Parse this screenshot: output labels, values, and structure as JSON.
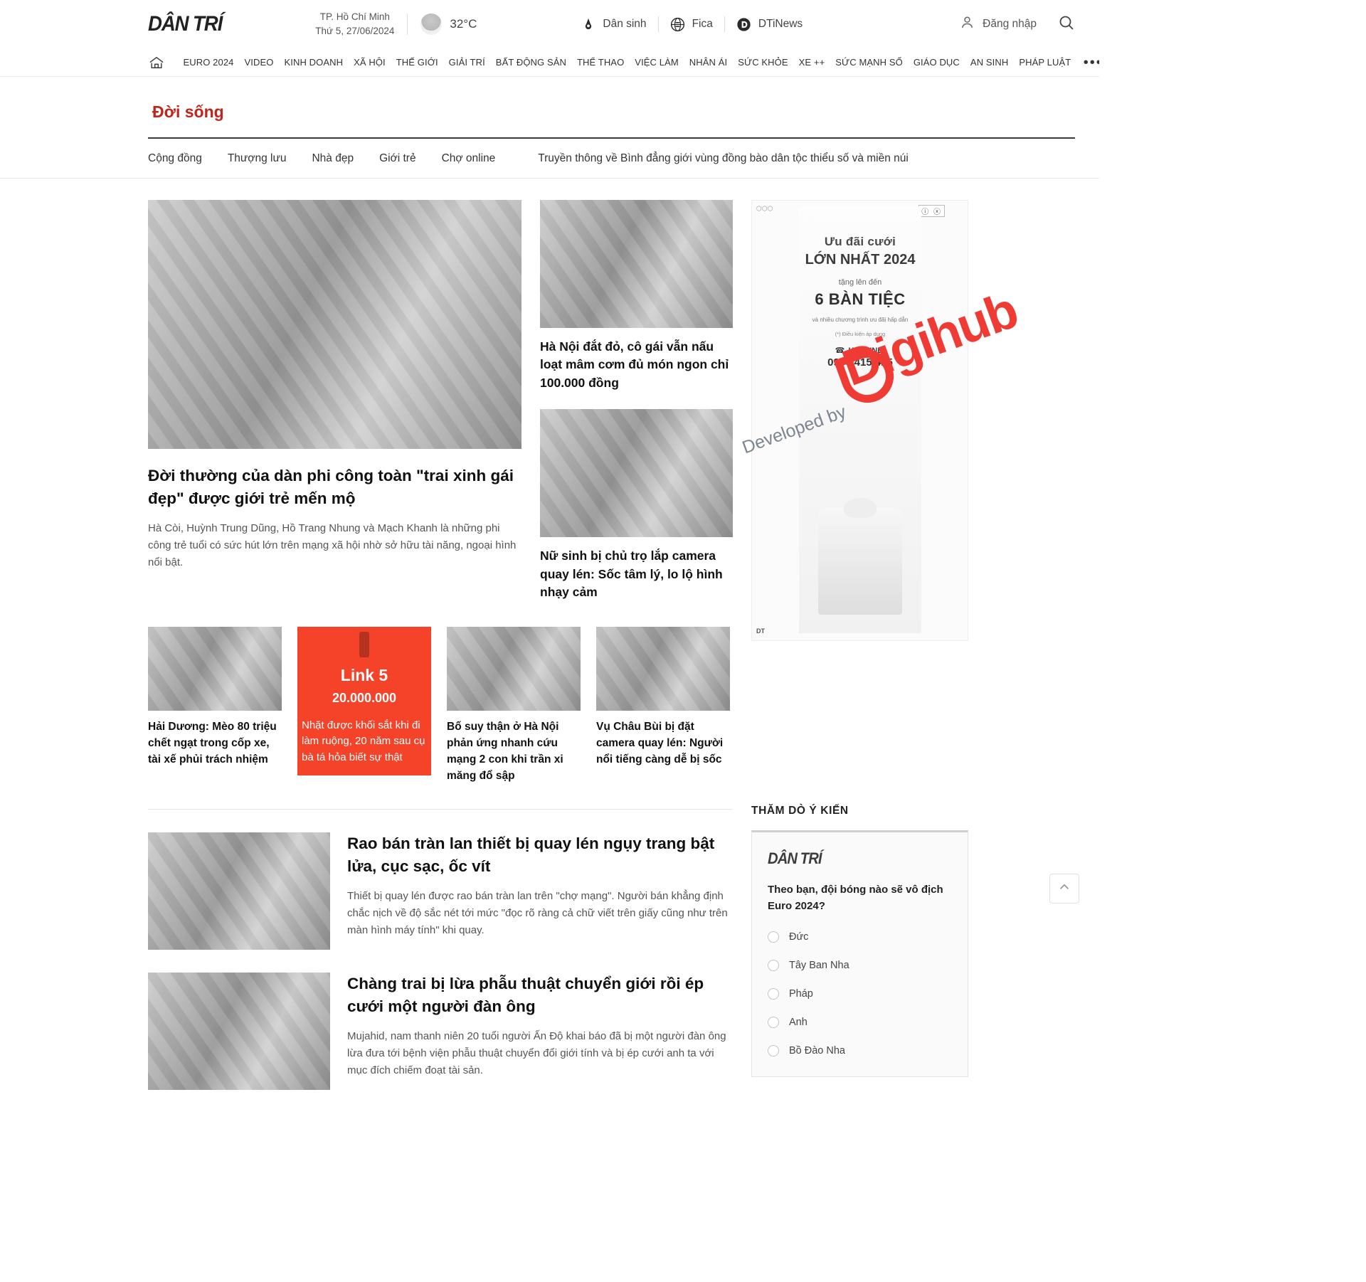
{
  "header": {
    "logo": "DÂN TRÍ",
    "location": "TP. Hồ Chí Minh",
    "date": "Thứ 5, 27/06/2024",
    "temperature": "32°C",
    "weather_icon": "cloud-icon",
    "partners": [
      {
        "label": "Dân sinh",
        "icon": "pen-drop-icon"
      },
      {
        "label": "Fica",
        "icon": "globe-icon"
      },
      {
        "label": "DTiNews",
        "icon": "dtinews-circle-icon"
      }
    ],
    "login_label": "Đăng nhập",
    "login_icon": "user-icon",
    "search_icon": "search-icon"
  },
  "mainnav": {
    "home_icon": "home-icon",
    "items": [
      "EURO 2024",
      "VIDEO",
      "KINH DOANH",
      "XÃ HỘI",
      "THẾ GIỚI",
      "GIẢI TRÍ",
      "BẤT ĐỘNG SẢN",
      "THỂ THAO",
      "VIỆC LÀM",
      "NHÂN ÁI",
      "SỨC KHỎE",
      "XE ++",
      "SỨC MẠNH SỐ",
      "GIÁO DỤC",
      "AN SINH",
      "PHÁP LUẬT"
    ],
    "more": "•••"
  },
  "section": {
    "title": "Đời sống",
    "highlight_color": "#f44329",
    "subnav": [
      "Cộng đồng",
      "Thượng lưu",
      "Nhà đẹp",
      "Giới trẻ",
      "Chợ online",
      "Truyền thông về Bình đẳng giới vùng đồng bào dân tộc thiểu số và miền núi"
    ]
  },
  "hero": {
    "title": "Đời thường của dàn phi công toàn \"trai xinh gái đẹp\" được giới trẻ mến mộ",
    "sapo": "Hà Còi, Huỳnh Trung Dũng, Hồ Trang Nhung và Mạch Khanh là những phi công trẻ tuổi có sức hút lớn trên mạng xã hội nhờ sở hữu tài năng, ngoại hình nổi bật."
  },
  "side_articles": [
    {
      "title": "Hà Nội đắt đỏ, cô gái vẫn nấu loạt mâm cơm đủ món ngon chỉ 100.000 đồng"
    },
    {
      "title": "Nữ sinh bị chủ trọ lắp camera quay lén: Sốc tâm lý, lo lộ hình nhạy cảm"
    }
  ],
  "thumbs": [
    {
      "title": "Hải Dương: Mèo 80 triệu chết ngạt trong cốp xe, tài xế phủi trách nhiệm",
      "promo": false
    },
    {
      "title": "Nhặt được khối sắt khi đi làm ruộng, 20 năm sau cụ bà tá hỏa biết sự thật",
      "promo": true,
      "promo_label": "Link 5",
      "promo_amount": "20.000.000"
    },
    {
      "title": "Bố suy thận ở Hà Nội phản ứng nhanh cứu mạng 2 con khi trần xi măng đổ sập",
      "promo": false
    },
    {
      "title": "Vụ Châu Bùi bị đặt camera quay lén: Người nổi tiếng càng dễ bị sốc",
      "promo": false
    }
  ],
  "list_articles": [
    {
      "title": "Rao bán tràn lan thiết bị quay lén ngụy trang bật lửa, cục sạc, ốc vít",
      "sapo": "Thiết bị quay lén được rao bán tràn lan trên \"chợ mạng\". Người bán khẳng định chắc nịch về độ sắc nét tới mức \"đọc rõ ràng cả chữ viết trên giấy cũng như trên màn hình máy tính\" khi quay."
    },
    {
      "title": "Chàng trai bị lừa phẫu thuật chuyển giới rồi ép cưới một người đàn ông",
      "sapo": "Mujahid, nam thanh niên 20 tuổi người Ấn Độ khai báo đã bị một người đàn ông lừa đưa tới bệnh viện phẫu thuật chuyển đổi giới tính và bị ép cưới anh ta với mục đích chiếm đoạt tài sản."
    }
  ],
  "ad": {
    "line1": "Ưu đãi cưới",
    "line2": "LỚN NHẤT 2024",
    "line3": "tặng lên đến",
    "line4": "6 BÀN TIỆC",
    "line5": "và nhiều chương trình ưu đãi hấp dẫn",
    "line6": "(*) Điều kiện áp dụng",
    "hotline_label": "HOTLINE:",
    "hotline_number": "0906 415 415",
    "corner_label": "ⓘ ⓧ",
    "brand_corner": "DT"
  },
  "watermark": {
    "prefix": "Developed by",
    "brand": "Digihub"
  },
  "poll": {
    "heading": "THĂM DÒ Ý KIẾN",
    "logo": "DÂN TRÍ",
    "question": "Theo bạn, đội bóng nào sẽ vô địch Euro 2024?",
    "options": [
      "Đức",
      "Tây Ban Nha",
      "Pháp",
      "Anh",
      "Bồ Đào Nha"
    ]
  },
  "scroll_top_icon": "chevron-up-icon"
}
